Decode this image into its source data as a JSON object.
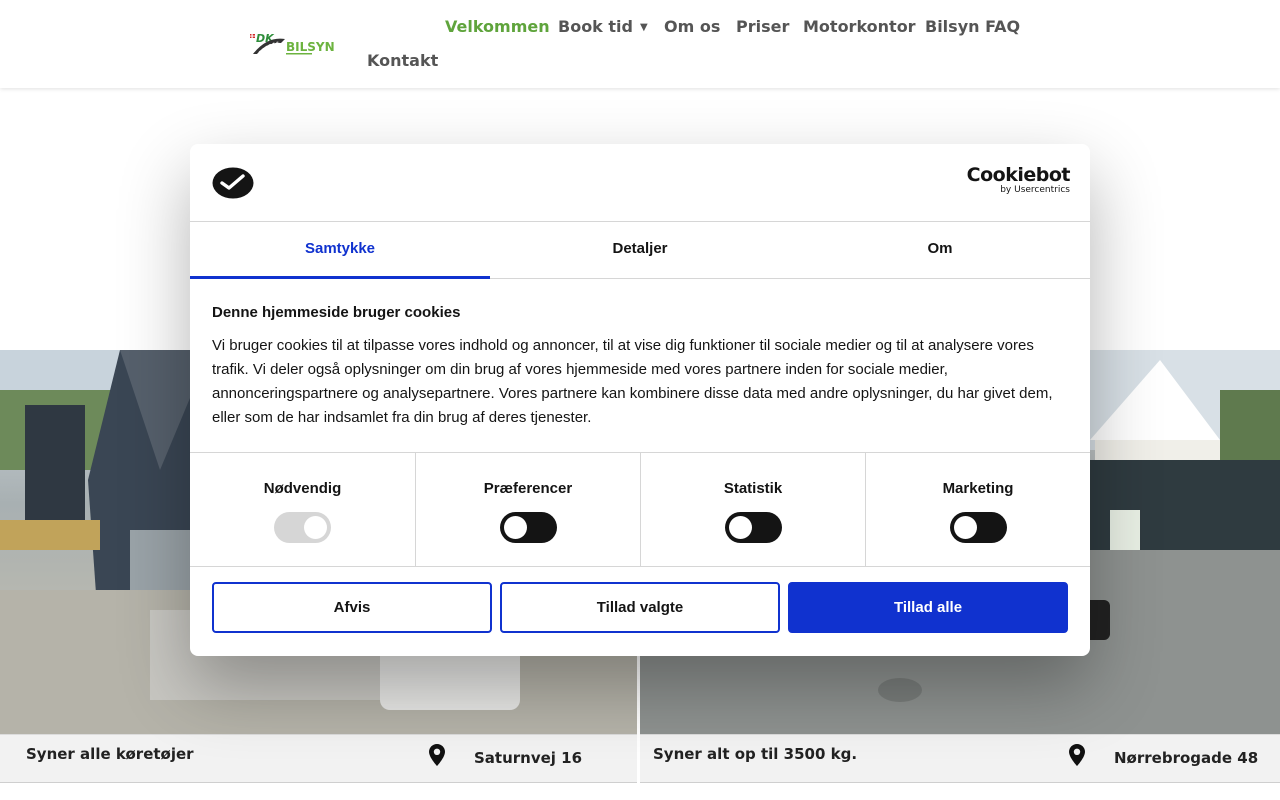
{
  "header": {
    "logo_text": "DK BILSYN",
    "nav": [
      {
        "label": "Velkommen",
        "active": true
      },
      {
        "label": "Book tid",
        "has_dropdown": true
      },
      {
        "label": "Om os"
      },
      {
        "label": "Priser"
      },
      {
        "label": "Motorkontor"
      },
      {
        "label": "Bilsyn FAQ"
      },
      {
        "label": "Kontakt"
      }
    ],
    "nav_active_color": "#5fa43c",
    "nav_color": "#555555"
  },
  "cookie_dialog": {
    "brand_name": "Cookiebot",
    "brand_sub": "by Usercentrics",
    "tabs": [
      {
        "label": "Samtykke",
        "active": true
      },
      {
        "label": "Detaljer"
      },
      {
        "label": "Om"
      }
    ],
    "title": "Denne hjemmeside bruger cookies",
    "body": "Vi bruger cookies til at tilpasse vores indhold og annoncer, til at vise dig funktioner til sociale medier og til at analysere vores trafik. Vi deler også oplysninger om din brug af vores hjemmeside med vores partnere inden for sociale medier, annonceringspartnere og analysepartnere. Vores partnere kan kombinere disse data med andre oplysninger, du har givet dem, eller som de har indsamlet fra din brug af deres tjenester.",
    "categories": [
      {
        "label": "Nødvendig",
        "enabled": true,
        "locked": true
      },
      {
        "label": "Præferencer",
        "enabled": false
      },
      {
        "label": "Statistik",
        "enabled": false
      },
      {
        "label": "Marketing",
        "enabled": false
      }
    ],
    "buttons": {
      "deny": "Afvis",
      "allow_selected": "Tillad valgte",
      "allow_all": "Tillad alle"
    },
    "accent_color": "#1032cf"
  },
  "locations": [
    {
      "caption": "Syner alle køretøjer",
      "address": "Saturnvej 16"
    },
    {
      "caption": "Syner alt op til 3500 kg.",
      "address": "Nørrebrogade 48"
    }
  ],
  "icons": {
    "location": "map-pin-icon"
  }
}
